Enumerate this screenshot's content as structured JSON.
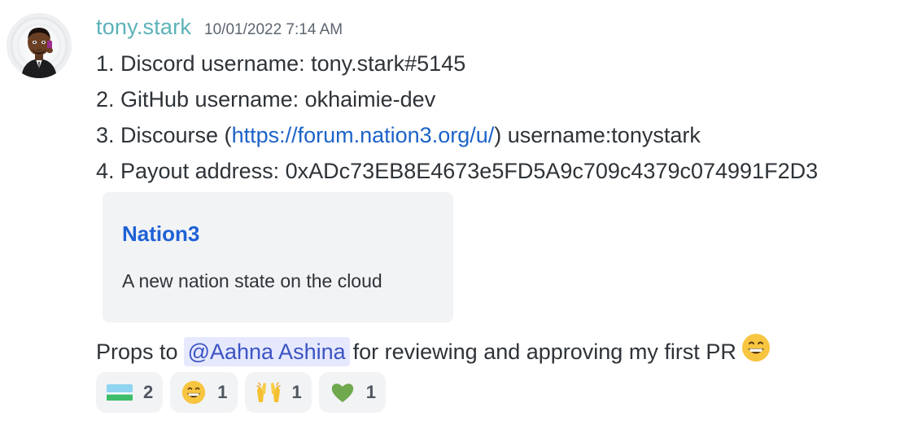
{
  "message": {
    "author": "tony.stark",
    "timestamp": "10/01/2022 7:14 AM",
    "lines": [
      "1. Discord username: tony.stark#5145",
      "2. GitHub username: okhaimie-dev",
      "3. Discourse (",
      "4. Payout address: 0xADc73EB8E4673e5FD5A9c709c4379c074991F2D3"
    ],
    "discourse_link": "https://forum.nation3.org/u/",
    "discourse_suffix": ") username:tonystark",
    "embed": {
      "title": "Nation3",
      "description": "A new nation state on the cloud"
    },
    "props": {
      "before": "Props to",
      "mention": "@Aahna Ashina",
      "after": "for reviewing and approving my first PR",
      "emoji": "grinning-face-emoji"
    }
  },
  "reactions": [
    {
      "emoji": "flag-emoji",
      "count": "2"
    },
    {
      "emoji": "grinning-face-emoji",
      "count": "1"
    },
    {
      "emoji": "raising-hands-emoji",
      "count": "1"
    },
    {
      "emoji": "green-heart-emoji",
      "count": "1"
    }
  ],
  "colors": {
    "author": "#5bb2b8",
    "link": "#1d63c8",
    "embed_title": "#1f61d6",
    "mention_bg": "#e6e9fd",
    "mention_text": "#3b53c4"
  }
}
